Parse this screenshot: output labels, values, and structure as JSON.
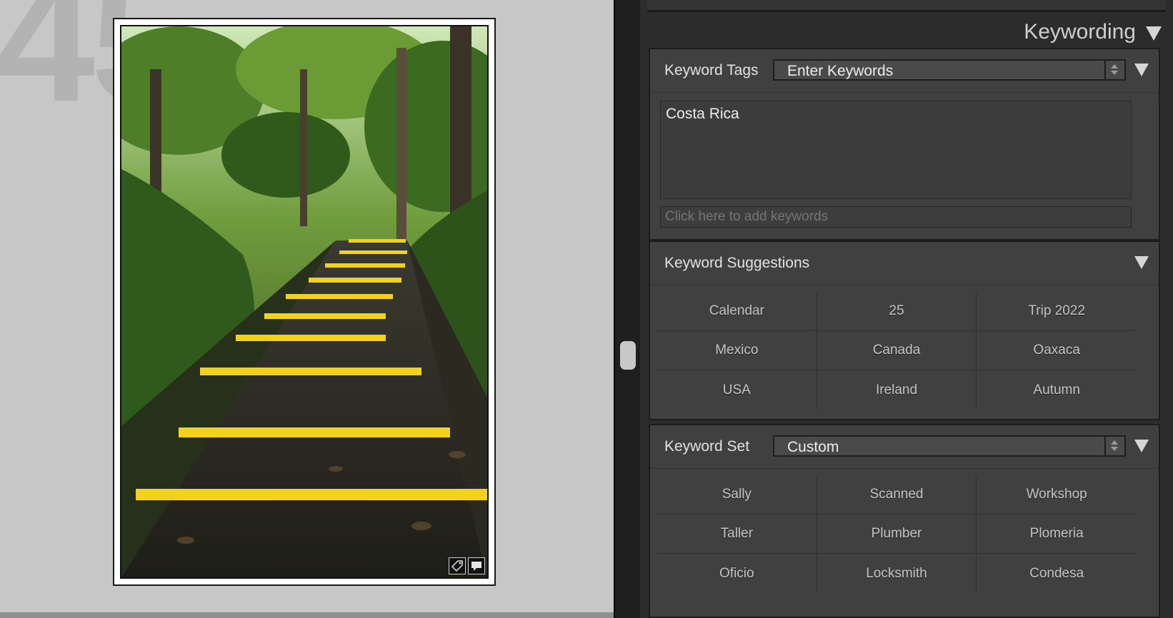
{
  "grid": {
    "cell_index": "45",
    "photo": {
      "kind": "forest staircase photo",
      "badges": [
        "keyword-tag-icon",
        "comment-icon"
      ]
    }
  },
  "panel": {
    "title": "Keywording",
    "keyword_tags": {
      "label": "Keyword Tags",
      "mode": "Enter Keywords",
      "keywords": "Costa Rica",
      "add_placeholder": "Click here to add keywords"
    },
    "suggestions": {
      "label": "Keyword Suggestions",
      "items": [
        "Calendar",
        "25",
        "Trip 2022",
        "Mexico",
        "Canada",
        "Oaxaca",
        "USA",
        "Ireland",
        "Autumn"
      ]
    },
    "keyword_set": {
      "label": "Keyword Set",
      "selected": "Custom",
      "items": [
        "Sally",
        "Scanned",
        "Workshop",
        "Taller",
        "Plumber",
        "Plomeria",
        "Oficio",
        "Locksmith",
        "Condesa"
      ]
    }
  },
  "colors": {
    "grid_background": "#c7c7c7",
    "panel_background": "#2c2c2c",
    "section_background": "#404040",
    "stair_paint": "#f2d21b"
  }
}
